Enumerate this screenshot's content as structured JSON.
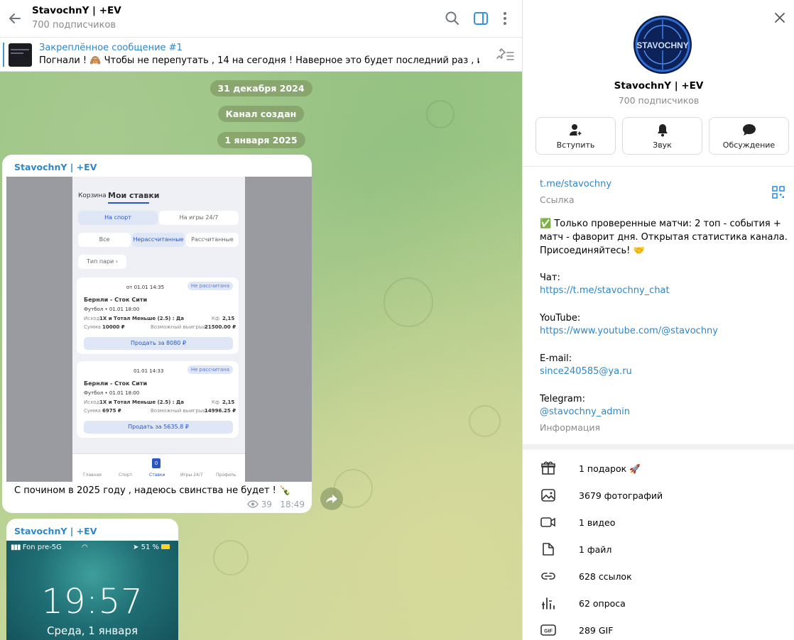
{
  "header": {
    "title": "StavochnY | +EV",
    "subscribers": "700 подписчиков"
  },
  "pinned": {
    "title": "Закреплённое сообщение #1",
    "text": "Погнали ! 🙈 Чтобы не перепутать , 14 на сегодня !  Наверное это будет последний раз , ибо пост..."
  },
  "service": {
    "date1": "31 декабря 2024",
    "created": "Канал создан",
    "date2": "1 января 2025"
  },
  "message1": {
    "author": "StavochnY | +EV",
    "text": "С почином в 2025 году , надеюсь свинства не будет ! 🍾",
    "views": "39",
    "time": "18:49",
    "screenshot": {
      "tab_basket": "Корзина",
      "tab_bets": "Мои ставки",
      "seg_sport": "На спорт",
      "seg_games": "На игры 24/7",
      "filter_all": "Все",
      "filter_unsettled": "Нерассчитанные",
      "filter_settled": "Рассчитанные",
      "bet_type": "Тип пари",
      "cards": [
        {
          "date": "от 01.01 14:35",
          "badge": "Не рассчитана",
          "match": "Бернли - Сток Сити",
          "league": "Футбол • 01.01 18:00",
          "outcome_label": "Исход",
          "outcome": "1X и Тотал Меньше (2.5) : Да",
          "coef_label": "Кф",
          "coef": "2,15",
          "sum_label": "Сумма",
          "sum": "10000 ₽",
          "win_label": "Возможный выигрыш",
          "win": "21500.00 ₽",
          "sell": "Продать за 8080 ₽"
        },
        {
          "date": "01.01 14:33",
          "badge": "Не рассчитана",
          "match": "Бернли - Сток Сити",
          "league": "Футбол • 01.01 18:00",
          "outcome_label": "Исход",
          "outcome": "1X и Тотал Меньше (2.5) : Да",
          "coef_label": "Кф",
          "coef": "2,15",
          "sum_label": "Сумма",
          "sum": "6975 ₽",
          "win_label": "Возможный выигрыш",
          "win": "14996.25 ₽",
          "sell": "Продать за 5635.8 ₽"
        }
      ],
      "nav": [
        "Главная",
        "Спорт",
        "Ставки",
        "Игры 24/7",
        "Профиль"
      ],
      "nav_badge": "0"
    }
  },
  "message2": {
    "author": "StavochnY | +EV",
    "lock": {
      "carrier": "Fon pre-5G",
      "battery": "51 %",
      "time": "19:57",
      "date": "Среда, 1 января"
    }
  },
  "panel": {
    "avatar_text": "STAVOCHNY",
    "title": "StavochnY | +EV",
    "subscribers": "700 подписчиков",
    "actions": [
      {
        "label": "Вступить",
        "icon": "join-icon"
      },
      {
        "label": "Звук",
        "icon": "bell-icon"
      },
      {
        "label": "Обсуждение",
        "icon": "chat-bubble-icon"
      }
    ],
    "link": "t.me/stavochny",
    "link_caption": "Ссылка",
    "description": "✅ Только проверенные матчи: 2 топ - события + матч - фаворит дня. Открытая статистика канала. Присоединяйтесь! 🤝",
    "chat_label": "Чат:",
    "chat_link": "https://t.me/stavochny_chat",
    "youtube_label": "YouTube:",
    "youtube_link": "https://www.youtube.com/@stavochny",
    "email_label": "E-mail:",
    "email": "since240585@ya.ru",
    "telegram_label": "Telegram:",
    "telegram": "@stavochny_admin",
    "info_caption": "Информация",
    "media": [
      {
        "label": "1 подарок 🚀",
        "icon": "gift-icon"
      },
      {
        "label": "3679 фотографий",
        "icon": "photo-icon"
      },
      {
        "label": "1 видео",
        "icon": "video-icon"
      },
      {
        "label": "1 файл",
        "icon": "file-icon"
      },
      {
        "label": "628 ссылок",
        "icon": "link-icon"
      },
      {
        "label": "62 опроса",
        "icon": "poll-icon"
      },
      {
        "label": "289 GIF",
        "icon": "gif-icon"
      }
    ]
  },
  "colors": {
    "accent": "#2e87c8",
    "muted": "#8a8a8a"
  }
}
